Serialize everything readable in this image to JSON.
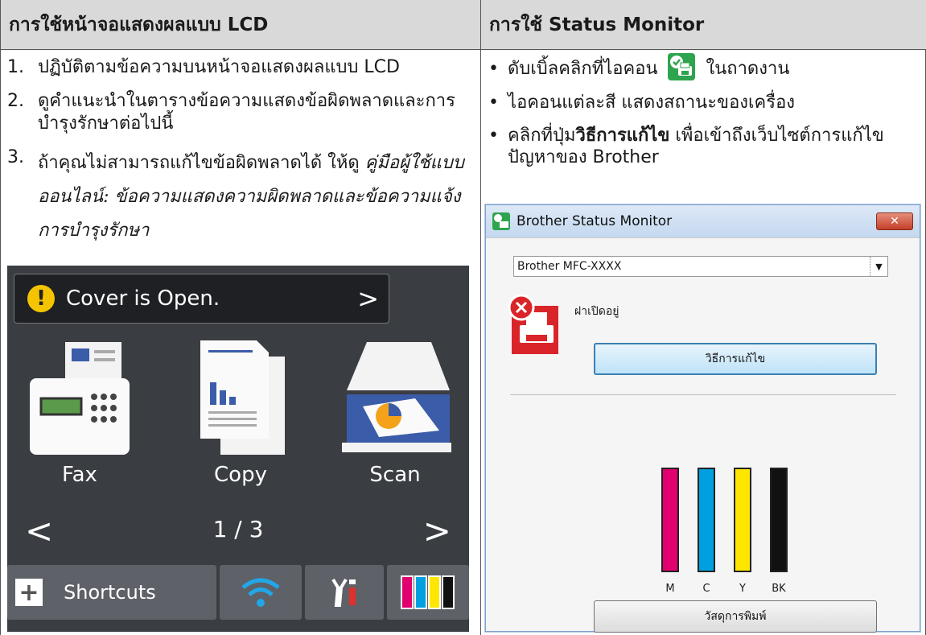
{
  "left_header": "การใช้หน้าจอแสดงผลแบบ LCD",
  "right_header": "การใช้ Status Monitor",
  "steps": [
    {
      "num": "1.",
      "text": "ปฏิบัติตามข้อความบนหน้าจอแสดงผลแบบ LCD"
    },
    {
      "num": "2.",
      "text": "ดูคำแนะนำในตารางข้อความแสดงข้อผิดพลาดและการบำรุงรักษาต่อไปนี้"
    },
    {
      "num": "3.",
      "text_plain": "ถ้าคุณไม่สามารถแก้ไขข้อผิดพลาดได้ ให้ดู ",
      "text_italic": "คู่มือผู้ใช้แบบออนไลน์",
      "text_sep": ": ",
      "text_italic2": "ข้อความแสดงความผิดพลาดและข้อความแจ้งการบำรุงรักษา"
    }
  ],
  "bullets": [
    {
      "before": "ดับเบิ้ลคลิกที่ไอคอน ",
      "after": " ในถาดงาน"
    },
    {
      "text": "ไอคอนแต่ละสี แสดงสถานะของเครื่อง"
    },
    {
      "before": "คลิกที่ปุ่ม",
      "bold": "วิธีการแก้ไข",
      "after": " เพื่อเข้าถึงเว็บไซต์การแก้ไขปัญหาของ Brother"
    }
  ],
  "lcd": {
    "status": "Cover is Open.",
    "apps": [
      "Fax",
      "Copy",
      "Scan"
    ],
    "page": "1 / 3",
    "shortcuts_label": "Shortcuts"
  },
  "monitor": {
    "title": "Brother Status Monitor",
    "device": "Brother MFC-XXXX",
    "state": "ฝาเปิดอยู่",
    "troubleshoot_button": "วิธีการแก้ไข",
    "supplies_button": "วัสดุการพิมพ์",
    "inks": [
      {
        "label": "M",
        "color": "#e0006e"
      },
      {
        "label": "C",
        "color": "#00a0e0"
      },
      {
        "label": "Y",
        "color": "#ffe600"
      },
      {
        "label": "BK",
        "color": "#111111"
      }
    ]
  }
}
